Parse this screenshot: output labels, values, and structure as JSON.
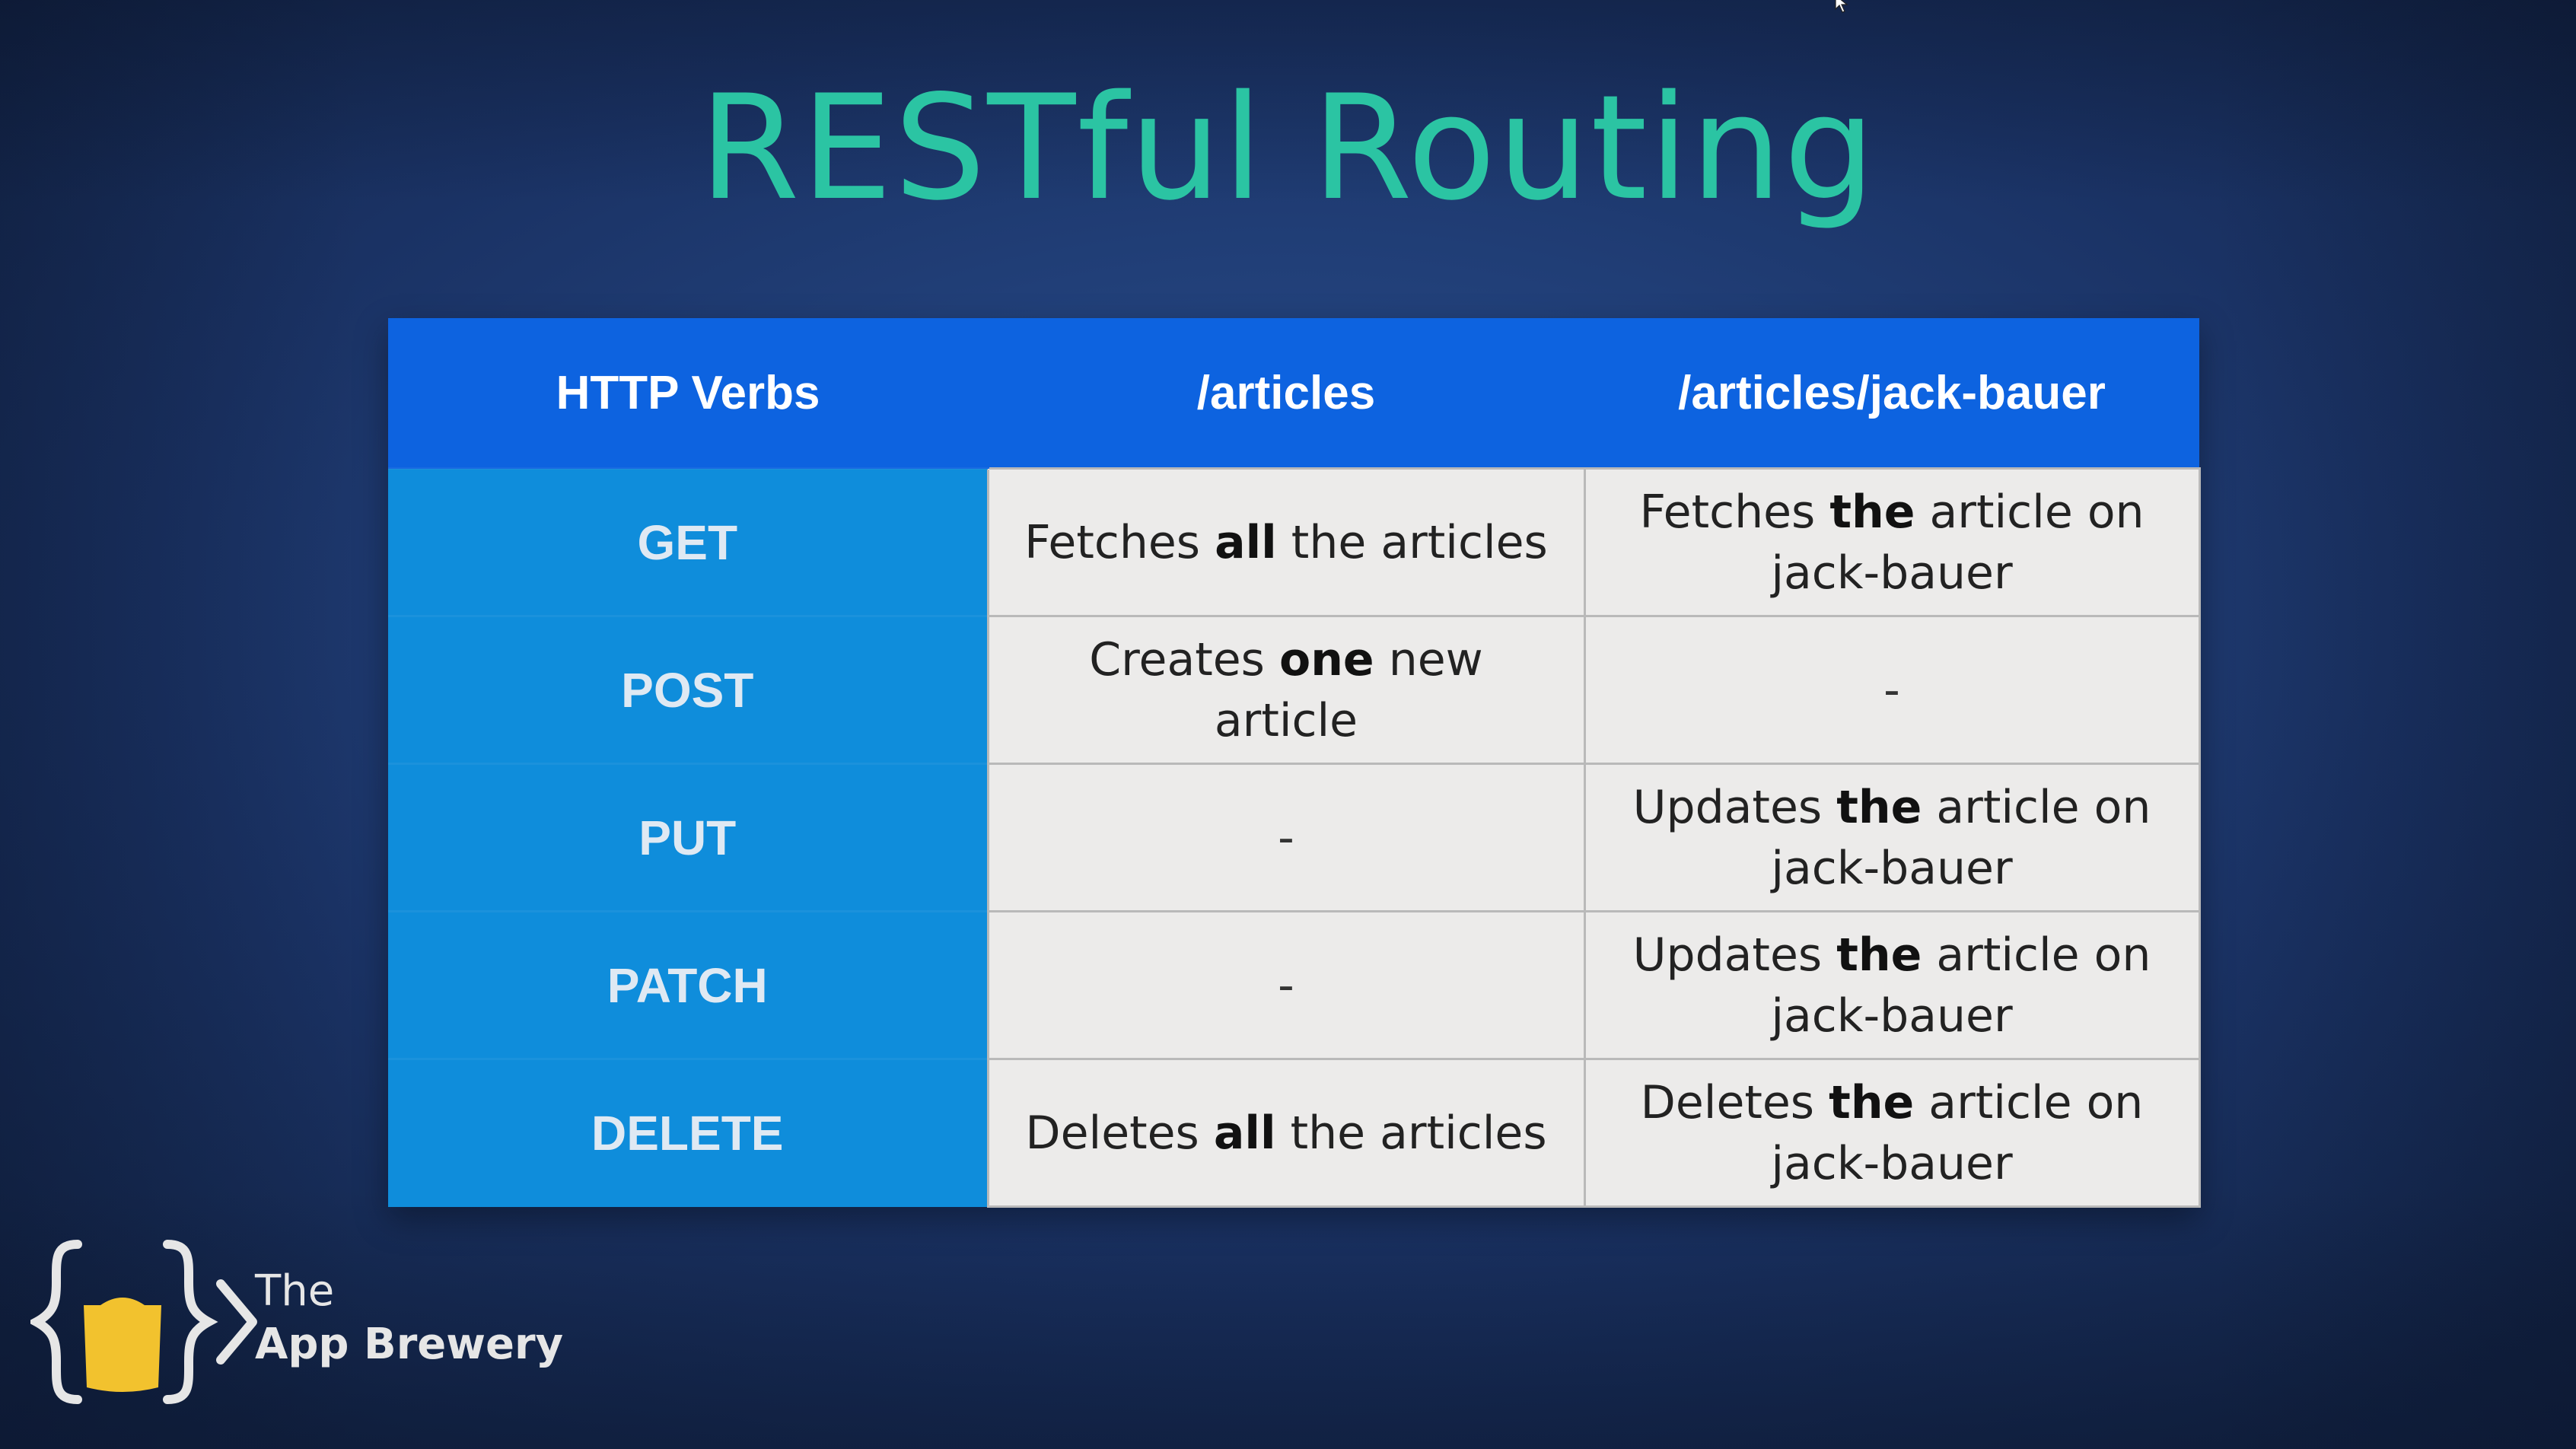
{
  "title": "RESTful Routing",
  "table": {
    "headers": [
      "HTTP Verbs",
      "/articles",
      "/articles/jack-bauer"
    ],
    "rows": [
      {
        "verb": "GET",
        "articles": {
          "pre": "Fetches ",
          "bold": "all",
          "post": " the articles"
        },
        "single": {
          "pre": "Fetches ",
          "bold": "the",
          "post": " article on jack-bauer"
        }
      },
      {
        "verb": "POST",
        "articles": {
          "pre": "Creates ",
          "bold": "one",
          "post": " new article"
        },
        "single": {
          "pre": "-",
          "bold": "",
          "post": ""
        }
      },
      {
        "verb": "PUT",
        "articles": {
          "pre": "-",
          "bold": "",
          "post": ""
        },
        "single": {
          "pre": "Updates ",
          "bold": "the",
          "post": " article on jack-bauer"
        }
      },
      {
        "verb": "PATCH",
        "articles": {
          "pre": "-",
          "bold": "",
          "post": ""
        },
        "single": {
          "pre": "Updates ",
          "bold": "the",
          "post": " article on jack-bauer"
        }
      },
      {
        "verb": "DELETE",
        "articles": {
          "pre": "Deletes ",
          "bold": "all",
          "post": " the articles"
        },
        "single": {
          "pre": "Deletes ",
          "bold": "the",
          "post": " article on jack-bauer"
        }
      }
    ]
  },
  "logo": {
    "line1": "The",
    "line2": "App Brewery",
    "icon": "beer-mug-braces-icon"
  },
  "colors": {
    "title": "#2bc4a3",
    "header_bg": "#0d63e0",
    "verb_bg": "#0f8ddb",
    "cell_bg": "#ecebea",
    "logo_mug": "#f2c22e"
  }
}
